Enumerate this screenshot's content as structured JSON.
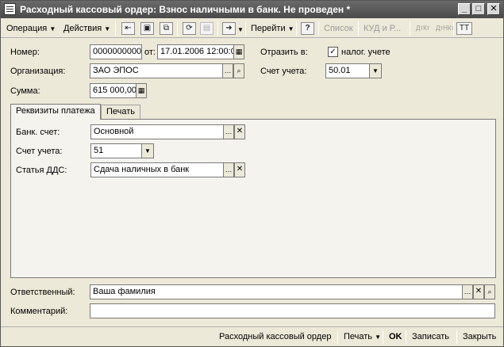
{
  "window": {
    "title": "Расходный кассовый ордер: Взнос наличными в банк. Не проведен *",
    "controls": {
      "minimize": "_",
      "maximize": "□",
      "close": "✕"
    }
  },
  "toolbar": {
    "operation": "Операция",
    "actions": "Действия",
    "goto": "Перейти",
    "help": "?",
    "list": "Список",
    "kud": "КУД и Р...",
    "dt_kt": "ДтКт",
    "dt_kt_n": "ДтНКт",
    "tt": "ТТ"
  },
  "form": {
    "number_label": "Номер:",
    "number_value": "0000000000",
    "from_label": "от:",
    "date_value": "17.01.2006 12:00:00",
    "reflect_label": "Отразить в:",
    "tax_checkbox_label": "налог. учете",
    "tax_checked": true,
    "org_label": "Организация:",
    "org_value": "ЗАО ЭПОС",
    "account_label": "Счет учета:",
    "account_value": "50.01",
    "sum_label": "Сумма:",
    "sum_value": "615 000,00"
  },
  "tabs": [
    {
      "label": "Реквизиты платежа",
      "active": true
    },
    {
      "label": "Печать",
      "active": false
    }
  ],
  "payment": {
    "bank_account_label": "Банк. счет:",
    "bank_account_value": "Основной",
    "account_label": "Счет учета:",
    "account_value": "51",
    "dds_label": "Статья ДДС:",
    "dds_value": "Сдача наличных в банк"
  },
  "footer_fields": {
    "responsible_label": "Ответственный:",
    "responsible_value": "Ваша фамилия",
    "comment_label": "Комментарий:",
    "comment_value": ""
  },
  "bottombar": {
    "doc_type": "Расходный кассовый ордер",
    "print": "Печать",
    "ok": "OK",
    "save": "Записать",
    "close": "Закрыть"
  }
}
